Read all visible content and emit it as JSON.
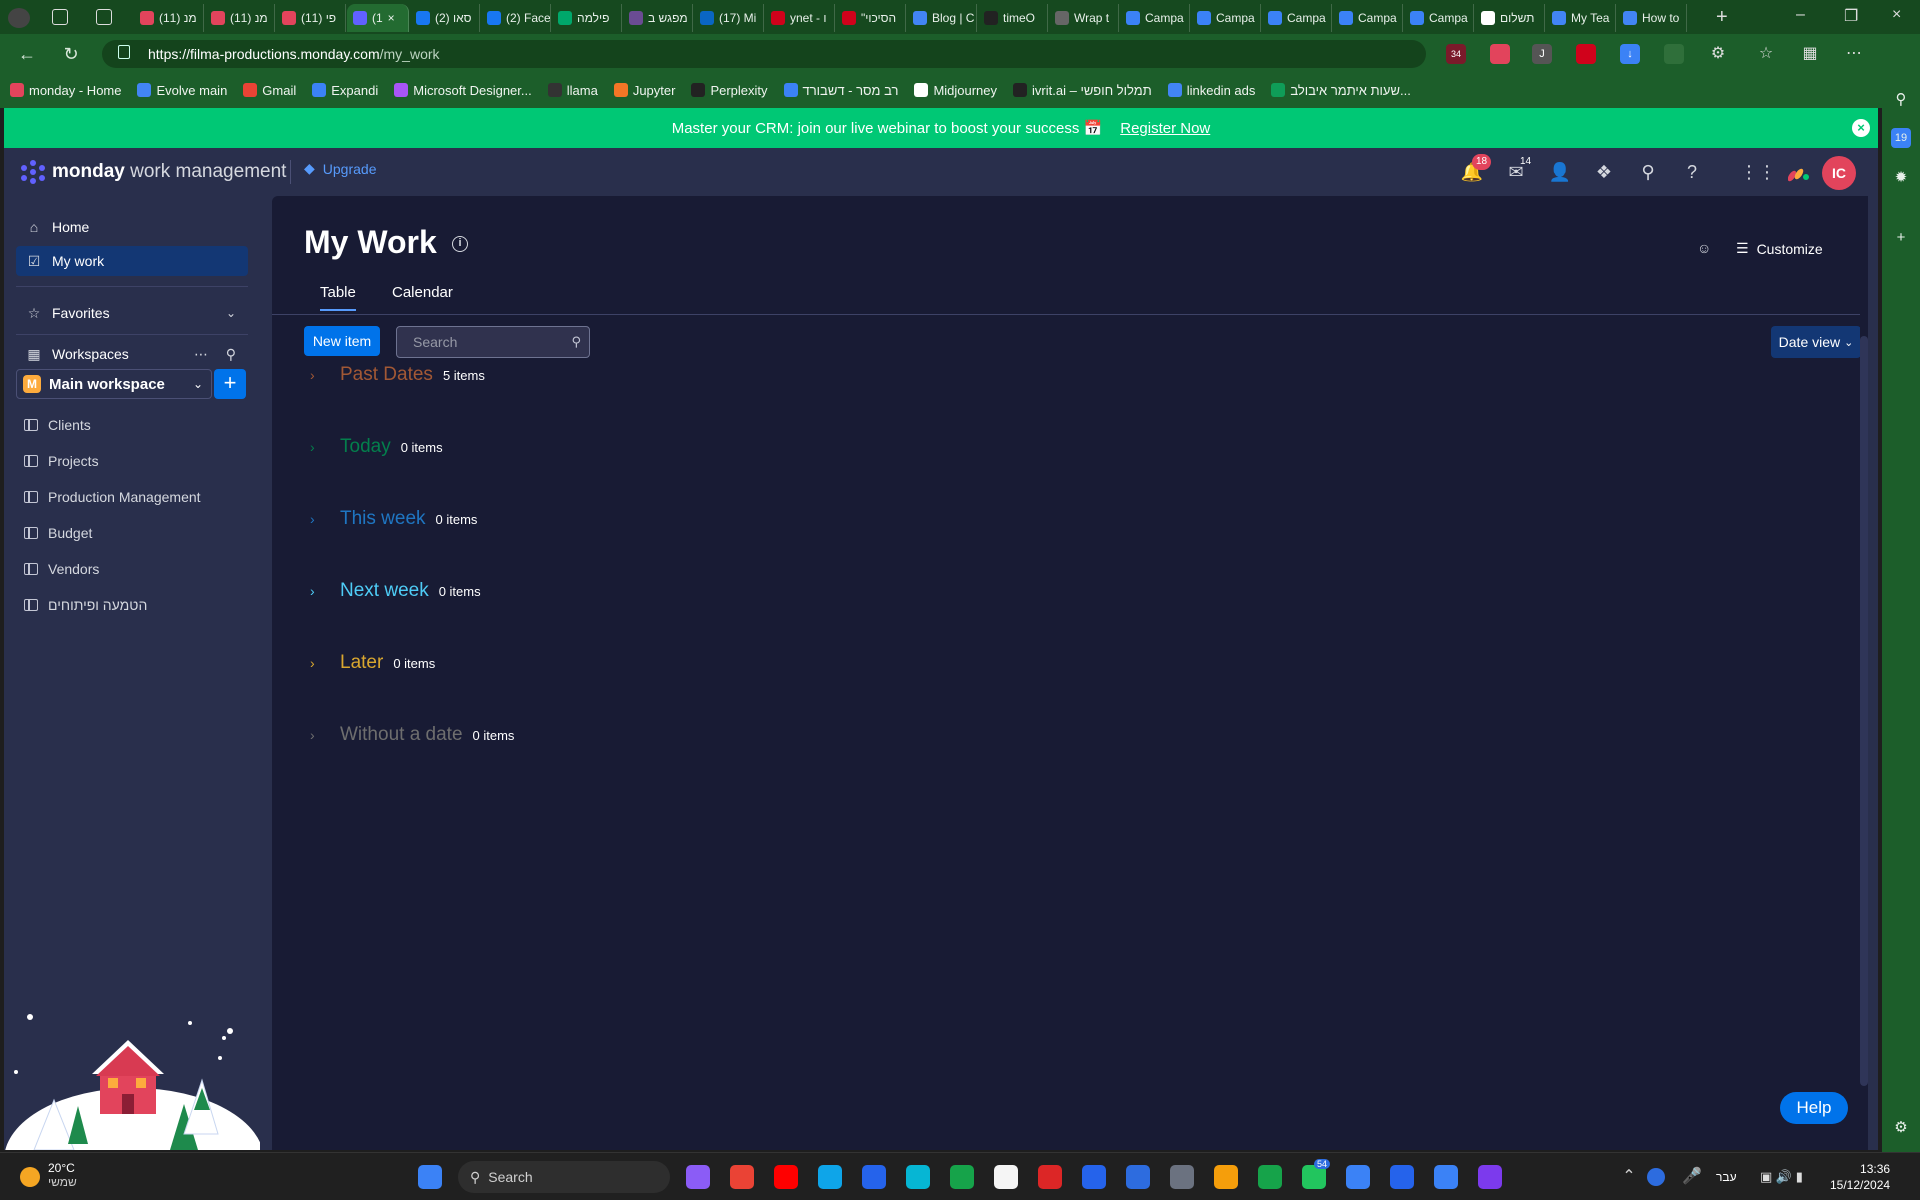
{
  "browser": {
    "tabs": [
      {
        "label": "(11) מנ",
        "color": "#e2445c"
      },
      {
        "label": "(11) מנ",
        "color": "#e2445c"
      },
      {
        "label": "(11) פי",
        "color": "#e2445c"
      },
      {
        "label": "(1",
        "color": "#6161ff",
        "active": true
      },
      {
        "label": "(2) סאו",
        "color": "#1877f2"
      },
      {
        "label": "(2) Face",
        "color": "#1877f2"
      },
      {
        "label": "פילמה",
        "color": "#00a86b"
      },
      {
        "label": "מפגש ב",
        "color": "#6a4c93"
      },
      {
        "label": "(17) Mi",
        "color": "#0a66c2"
      },
      {
        "label": "ynet - ו",
        "color": "#d0021b"
      },
      {
        "label": "\"הסיכוי",
        "color": "#d0021b"
      },
      {
        "label": "Blog | C",
        "color": "#4285f4"
      },
      {
        "label": "timeO",
        "color": "#222222"
      },
      {
        "label": "Wrap t",
        "color": "#666666"
      },
      {
        "label": "Campa",
        "color": "#3b82f6"
      },
      {
        "label": "Campa",
        "color": "#3b82f6"
      },
      {
        "label": "Campa",
        "color": "#3b82f6"
      },
      {
        "label": "Campa",
        "color": "#3b82f6"
      },
      {
        "label": "Campa",
        "color": "#3b82f6"
      },
      {
        "label": "תשלום",
        "color": "#ffffff"
      },
      {
        "label": "My Tea",
        "color": "#4285f4"
      },
      {
        "label": "How to",
        "color": "#4285f4"
      }
    ],
    "url_host": "https://filma-productions.monday.com",
    "url_path": "/my_work",
    "bookmarks": [
      {
        "label": "monday - Home",
        "color": "#e2445c"
      },
      {
        "label": "Evolve main",
        "color": "#4285f4"
      },
      {
        "label": "Gmail",
        "color": "#ea4335"
      },
      {
        "label": "Expandi",
        "color": "#3b82f6"
      },
      {
        "label": "Microsoft Designer...",
        "color": "#a855f7"
      },
      {
        "label": "llama",
        "color": "#333333"
      },
      {
        "label": "Jupyter",
        "color": "#f37626"
      },
      {
        "label": "Perplexity",
        "color": "#222222"
      },
      {
        "label": "רב מסר - דשבורד",
        "color": "#3b82f6"
      },
      {
        "label": "Midjourney",
        "color": "#ffffff"
      },
      {
        "label": "ivrit.ai – תמלול חופשי",
        "color": "#222222"
      },
      {
        "label": "linkedin ads",
        "color": "#4285f4"
      },
      {
        "label": "שעות איתמר איבולב...",
        "color": "#0f9d58"
      }
    ],
    "ext_badge": "34"
  },
  "banner": {
    "text": "Master your CRM: join our live webinar to boost your success 📅",
    "link": "Register Now"
  },
  "topbar": {
    "brand_bold": "monday",
    "brand_rest": " work management",
    "upgrade": "Upgrade",
    "notifications_count": "18",
    "inbox_count": "14",
    "avatar_initials": "IC"
  },
  "leftnav": {
    "home": "Home",
    "my_work": "My work",
    "favorites": "Favorites",
    "workspaces": "Workspaces",
    "workspace_name": "Main workspace",
    "workspace_initial": "M",
    "boards": [
      "Clients",
      "Projects",
      "Production Management",
      "Budget",
      "Vendors",
      "הטמעה ופיתוחים"
    ]
  },
  "main": {
    "title": "My Work",
    "customize": "Customize",
    "tabs": [
      "Table",
      "Calendar"
    ],
    "new_item": "New item",
    "search_placeholder": "Search",
    "date_view": "Date view",
    "groups": [
      {
        "name": "Past Dates",
        "count": "5 items",
        "color": "#a25835"
      },
      {
        "name": "Today",
        "count": "0 items",
        "color": "#037f4c"
      },
      {
        "name": "This week",
        "count": "0 items",
        "color": "#1f76c2"
      },
      {
        "name": "Next week",
        "count": "0 items",
        "color": "#4eccf6"
      },
      {
        "name": "Later",
        "count": "0 items",
        "color": "#d9a72f"
      },
      {
        "name": "Without a date",
        "count": "0 items",
        "color": "#6e6e6e"
      }
    ],
    "help": "Help"
  },
  "taskbar": {
    "temp": "20°C",
    "weather_label": "שמשי",
    "search": "Search",
    "lang": "עבר",
    "time": "13:36",
    "date": "15/12/2024",
    "whatsapp_badge": "54"
  }
}
